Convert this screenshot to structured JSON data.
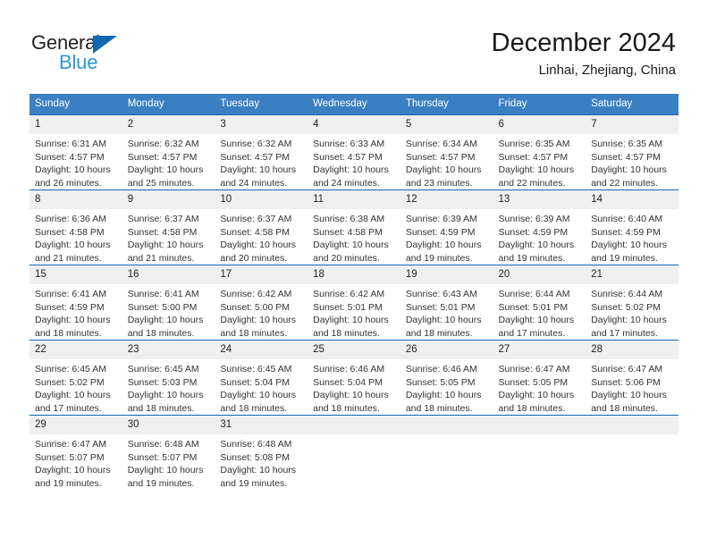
{
  "brand": {
    "name_part1": "General",
    "name_part2": "Blue",
    "accent_color": "#1268b3",
    "accent_color_light": "#2e97d4"
  },
  "header": {
    "title": "December 2024",
    "subtitle": "Linhai, Zhejiang, China"
  },
  "calendar": {
    "header_bg": "#3a7fc1",
    "row_divider_color": "#1268b3",
    "daynum_bg": "#efefef",
    "weekdays": [
      "Sunday",
      "Monday",
      "Tuesday",
      "Wednesday",
      "Thursday",
      "Friday",
      "Saturday"
    ],
    "weeks": [
      [
        {
          "day": "1",
          "sunrise": "Sunrise: 6:31 AM",
          "sunset": "Sunset: 4:57 PM",
          "daylight1": "Daylight: 10 hours",
          "daylight2": "and 26 minutes."
        },
        {
          "day": "2",
          "sunrise": "Sunrise: 6:32 AM",
          "sunset": "Sunset: 4:57 PM",
          "daylight1": "Daylight: 10 hours",
          "daylight2": "and 25 minutes."
        },
        {
          "day": "3",
          "sunrise": "Sunrise: 6:32 AM",
          "sunset": "Sunset: 4:57 PM",
          "daylight1": "Daylight: 10 hours",
          "daylight2": "and 24 minutes."
        },
        {
          "day": "4",
          "sunrise": "Sunrise: 6:33 AM",
          "sunset": "Sunset: 4:57 PM",
          "daylight1": "Daylight: 10 hours",
          "daylight2": "and 24 minutes."
        },
        {
          "day": "5",
          "sunrise": "Sunrise: 6:34 AM",
          "sunset": "Sunset: 4:57 PM",
          "daylight1": "Daylight: 10 hours",
          "daylight2": "and 23 minutes."
        },
        {
          "day": "6",
          "sunrise": "Sunrise: 6:35 AM",
          "sunset": "Sunset: 4:57 PM",
          "daylight1": "Daylight: 10 hours",
          "daylight2": "and 22 minutes."
        },
        {
          "day": "7",
          "sunrise": "Sunrise: 6:35 AM",
          "sunset": "Sunset: 4:57 PM",
          "daylight1": "Daylight: 10 hours",
          "daylight2": "and 22 minutes."
        }
      ],
      [
        {
          "day": "8",
          "sunrise": "Sunrise: 6:36 AM",
          "sunset": "Sunset: 4:58 PM",
          "daylight1": "Daylight: 10 hours",
          "daylight2": "and 21 minutes."
        },
        {
          "day": "9",
          "sunrise": "Sunrise: 6:37 AM",
          "sunset": "Sunset: 4:58 PM",
          "daylight1": "Daylight: 10 hours",
          "daylight2": "and 21 minutes."
        },
        {
          "day": "10",
          "sunrise": "Sunrise: 6:37 AM",
          "sunset": "Sunset: 4:58 PM",
          "daylight1": "Daylight: 10 hours",
          "daylight2": "and 20 minutes."
        },
        {
          "day": "11",
          "sunrise": "Sunrise: 6:38 AM",
          "sunset": "Sunset: 4:58 PM",
          "daylight1": "Daylight: 10 hours",
          "daylight2": "and 20 minutes."
        },
        {
          "day": "12",
          "sunrise": "Sunrise: 6:39 AM",
          "sunset": "Sunset: 4:59 PM",
          "daylight1": "Daylight: 10 hours",
          "daylight2": "and 19 minutes."
        },
        {
          "day": "13",
          "sunrise": "Sunrise: 6:39 AM",
          "sunset": "Sunset: 4:59 PM",
          "daylight1": "Daylight: 10 hours",
          "daylight2": "and 19 minutes."
        },
        {
          "day": "14",
          "sunrise": "Sunrise: 6:40 AM",
          "sunset": "Sunset: 4:59 PM",
          "daylight1": "Daylight: 10 hours",
          "daylight2": "and 19 minutes."
        }
      ],
      [
        {
          "day": "15",
          "sunrise": "Sunrise: 6:41 AM",
          "sunset": "Sunset: 4:59 PM",
          "daylight1": "Daylight: 10 hours",
          "daylight2": "and 18 minutes."
        },
        {
          "day": "16",
          "sunrise": "Sunrise: 6:41 AM",
          "sunset": "Sunset: 5:00 PM",
          "daylight1": "Daylight: 10 hours",
          "daylight2": "and 18 minutes."
        },
        {
          "day": "17",
          "sunrise": "Sunrise: 6:42 AM",
          "sunset": "Sunset: 5:00 PM",
          "daylight1": "Daylight: 10 hours",
          "daylight2": "and 18 minutes."
        },
        {
          "day": "18",
          "sunrise": "Sunrise: 6:42 AM",
          "sunset": "Sunset: 5:01 PM",
          "daylight1": "Daylight: 10 hours",
          "daylight2": "and 18 minutes."
        },
        {
          "day": "19",
          "sunrise": "Sunrise: 6:43 AM",
          "sunset": "Sunset: 5:01 PM",
          "daylight1": "Daylight: 10 hours",
          "daylight2": "and 18 minutes."
        },
        {
          "day": "20",
          "sunrise": "Sunrise: 6:44 AM",
          "sunset": "Sunset: 5:01 PM",
          "daylight1": "Daylight: 10 hours",
          "daylight2": "and 17 minutes."
        },
        {
          "day": "21",
          "sunrise": "Sunrise: 6:44 AM",
          "sunset": "Sunset: 5:02 PM",
          "daylight1": "Daylight: 10 hours",
          "daylight2": "and 17 minutes."
        }
      ],
      [
        {
          "day": "22",
          "sunrise": "Sunrise: 6:45 AM",
          "sunset": "Sunset: 5:02 PM",
          "daylight1": "Daylight: 10 hours",
          "daylight2": "and 17 minutes."
        },
        {
          "day": "23",
          "sunrise": "Sunrise: 6:45 AM",
          "sunset": "Sunset: 5:03 PM",
          "daylight1": "Daylight: 10 hours",
          "daylight2": "and 18 minutes."
        },
        {
          "day": "24",
          "sunrise": "Sunrise: 6:45 AM",
          "sunset": "Sunset: 5:04 PM",
          "daylight1": "Daylight: 10 hours",
          "daylight2": "and 18 minutes."
        },
        {
          "day": "25",
          "sunrise": "Sunrise: 6:46 AM",
          "sunset": "Sunset: 5:04 PM",
          "daylight1": "Daylight: 10 hours",
          "daylight2": "and 18 minutes."
        },
        {
          "day": "26",
          "sunrise": "Sunrise: 6:46 AM",
          "sunset": "Sunset: 5:05 PM",
          "daylight1": "Daylight: 10 hours",
          "daylight2": "and 18 minutes."
        },
        {
          "day": "27",
          "sunrise": "Sunrise: 6:47 AM",
          "sunset": "Sunset: 5:05 PM",
          "daylight1": "Daylight: 10 hours",
          "daylight2": "and 18 minutes."
        },
        {
          "day": "28",
          "sunrise": "Sunrise: 6:47 AM",
          "sunset": "Sunset: 5:06 PM",
          "daylight1": "Daylight: 10 hours",
          "daylight2": "and 18 minutes."
        }
      ],
      [
        {
          "day": "29",
          "sunrise": "Sunrise: 6:47 AM",
          "sunset": "Sunset: 5:07 PM",
          "daylight1": "Daylight: 10 hours",
          "daylight2": "and 19 minutes."
        },
        {
          "day": "30",
          "sunrise": "Sunrise: 6:48 AM",
          "sunset": "Sunset: 5:07 PM",
          "daylight1": "Daylight: 10 hours",
          "daylight2": "and 19 minutes."
        },
        {
          "day": "31",
          "sunrise": "Sunrise: 6:48 AM",
          "sunset": "Sunset: 5:08 PM",
          "daylight1": "Daylight: 10 hours",
          "daylight2": "and 19 minutes."
        },
        {
          "day": "",
          "sunrise": "",
          "sunset": "",
          "daylight1": "",
          "daylight2": ""
        },
        {
          "day": "",
          "sunrise": "",
          "sunset": "",
          "daylight1": "",
          "daylight2": ""
        },
        {
          "day": "",
          "sunrise": "",
          "sunset": "",
          "daylight1": "",
          "daylight2": ""
        },
        {
          "day": "",
          "sunrise": "",
          "sunset": "",
          "daylight1": "",
          "daylight2": ""
        }
      ]
    ]
  }
}
